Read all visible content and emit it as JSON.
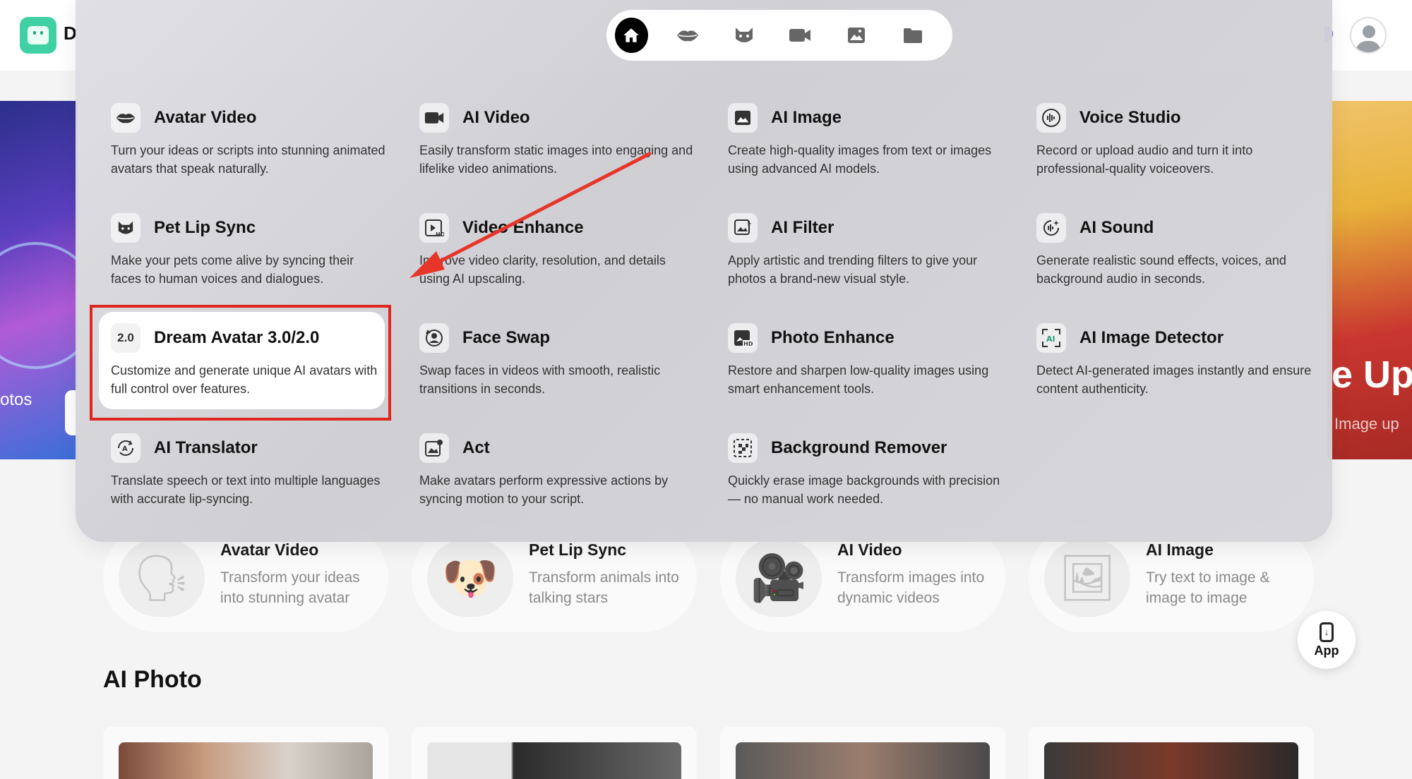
{
  "header": {
    "brand_letter": "D"
  },
  "hero": {
    "left_text": "otos",
    "right_title": "e Up",
    "right_subtitle": "Image up"
  },
  "features": [
    {
      "title": "Avatar Video",
      "desc": "Transform your ideas into stunning avatar",
      "icon": "speaking-head-icon"
    },
    {
      "title": "Pet Lip Sync",
      "desc": "Transform animals into talking stars",
      "icon": "pet-microphone-icon"
    },
    {
      "title": "AI Video",
      "desc": "Transform images into dynamic videos",
      "icon": "video-camera-icon"
    },
    {
      "title": "AI Image",
      "desc": "Try text to image & image to image",
      "icon": "image-edit-icon"
    }
  ],
  "section": {
    "ai_photo_title": "AI Photo"
  },
  "app_button": {
    "label": "App"
  },
  "nav_tabs": [
    {
      "name": "home",
      "icon": "home-icon",
      "active": true
    },
    {
      "name": "lips",
      "icon": "lips-icon",
      "active": false
    },
    {
      "name": "pet",
      "icon": "cat-icon",
      "active": false
    },
    {
      "name": "video",
      "icon": "video-camera-icon",
      "active": false
    },
    {
      "name": "image",
      "icon": "image-icon",
      "active": false
    },
    {
      "name": "folder",
      "icon": "folder-icon",
      "active": false
    }
  ],
  "menu": {
    "items": [
      {
        "title": "Avatar Video",
        "desc": "Turn your ideas or scripts into stunning animated avatars that speak naturally.",
        "icon": "lips-icon"
      },
      {
        "title": "AI Video",
        "desc": "Easily transform static images into engaging and lifelike video animations.",
        "icon": "video-camera-icon"
      },
      {
        "title": "AI Image",
        "desc": "Create high-quality images from text or images using advanced AI models.",
        "icon": "image-icon"
      },
      {
        "title": "Voice Studio",
        "desc": "Record or upload audio and turn it into professional-quality voiceovers.",
        "icon": "sound-wave-icon"
      },
      {
        "title": "Pet Lip Sync",
        "desc": "Make your pets come alive by syncing their faces to human voices and dialogues.",
        "icon": "cat-icon"
      },
      {
        "title": "Video Enhance",
        "desc": "Improve video clarity, resolution, and details using AI upscaling.",
        "icon": "hd-video-icon"
      },
      {
        "title": "AI Filter",
        "desc": "Apply artistic and trending filters to give your photos a brand-new visual style.",
        "icon": "filter-icon"
      },
      {
        "title": "AI Sound",
        "desc": "Generate realistic sound effects, voices, and background audio in seconds.",
        "icon": "sound-sparkle-icon"
      },
      {
        "title": "Dream Avatar 3.0/2.0",
        "desc": "Customize and generate unique AI avatars with full control over features.",
        "icon": "badge-2-0-icon",
        "icon_text": "2.0"
      },
      {
        "title": "Face Swap",
        "desc": "Swap faces in videos with smooth, realistic transitions in seconds.",
        "icon": "face-swap-icon"
      },
      {
        "title": "Photo Enhance",
        "desc": "Restore and sharpen low-quality images using smart enhancement tools.",
        "icon": "hd-photo-icon"
      },
      {
        "title": "AI Image Detector",
        "desc": "Detect AI-generated images instantly and ensure content authenticity.",
        "icon": "ai-scan-icon"
      },
      {
        "title": "AI Translator",
        "desc": "Translate speech or text into multiple languages with accurate lip-syncing.",
        "icon": "translate-icon"
      },
      {
        "title": "Act",
        "desc": "Make avatars perform expressive actions by syncing motion to your script.",
        "icon": "act-image-icon"
      },
      {
        "title": "Background Remover",
        "desc": "Quickly erase image backgrounds with precision — no manual work needed.",
        "icon": "background-remove-icon"
      }
    ]
  },
  "colors": {
    "highlight_box": "#e0271f",
    "arrow": "#e8352a",
    "brand": "#3fd1a3",
    "active_nav": "#000000"
  }
}
